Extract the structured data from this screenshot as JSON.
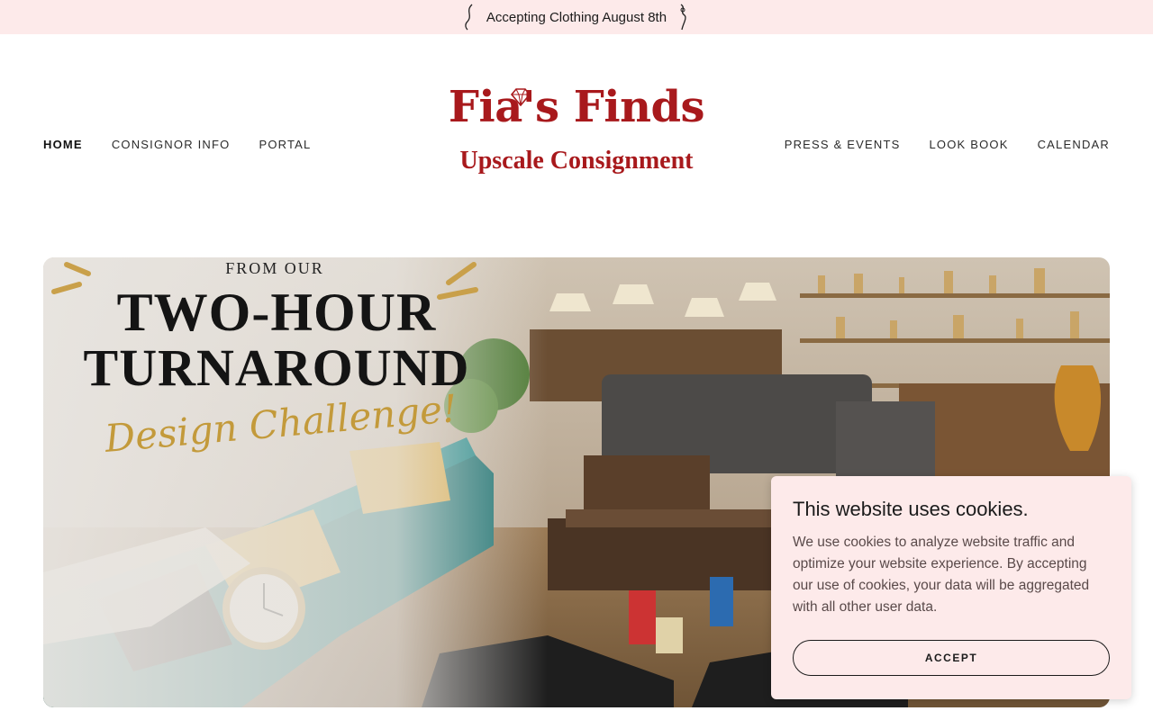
{
  "announcement": {
    "text": "Accepting Clothing August 8th",
    "icon": "flourish-icon"
  },
  "nav": {
    "left": [
      {
        "label": "HOME",
        "active": true
      },
      {
        "label": "CONSIGNOR INFO",
        "active": false
      },
      {
        "label": "PORTAL",
        "active": false
      }
    ],
    "right": [
      {
        "label": "PRESS & EVENTS",
        "active": false
      },
      {
        "label": "LOOK BOOK",
        "active": false
      },
      {
        "label": "CALENDAR",
        "active": false
      }
    ]
  },
  "logo": {
    "title": "Fia's Finds",
    "subtitle": "Upscale Consignment",
    "color": "#a8191c",
    "icon": "diamond-icon"
  },
  "hero": {
    "kicker": "FROM OUR",
    "headline_line1": "TWO-HOUR",
    "headline_line2": "TURNAROUND",
    "script": "Design Challenge!",
    "accent_color": "#c39a3b"
  },
  "cookie_banner": {
    "title": "This website uses cookies.",
    "body": "We use cookies to analyze website traffic and optimize your website experience. By accepting our use of cookies, your data will be aggregated with all other user data.",
    "accept_label": "ACCEPT",
    "background": "#fdeaea"
  },
  "colors": {
    "announcement_bg": "#fdeaea",
    "brand": "#a8191c"
  }
}
